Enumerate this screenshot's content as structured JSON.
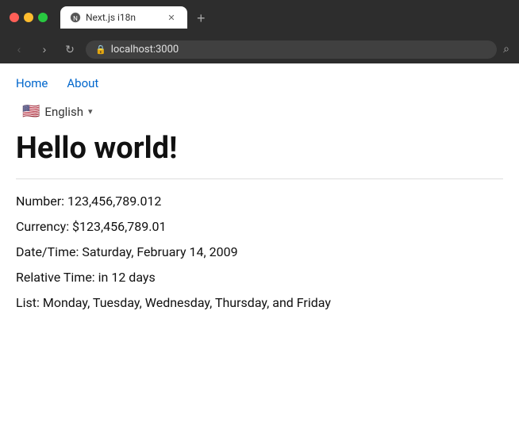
{
  "browser": {
    "tab_title": "Next.js i18n",
    "url": "localhost:3000",
    "new_tab_label": "+"
  },
  "nav": {
    "back_label": "←",
    "forward_label": "→",
    "refresh_label": "↻"
  },
  "page": {
    "nav_links": [
      {
        "label": "Home",
        "active": true
      },
      {
        "label": "About",
        "active": false
      }
    ],
    "language": {
      "flag": "🇺🇸",
      "label": "English"
    },
    "heading": "Hello world!",
    "items": [
      {
        "label": "Number:",
        "value": "123,456,789.012"
      },
      {
        "label": "Currency:",
        "value": "$123,456,789.01"
      },
      {
        "label": "Date/Time:",
        "value": "Saturday, February 14, 2009"
      },
      {
        "label": "Relative Time:",
        "value": "in 12 days"
      },
      {
        "label": "List:",
        "value": "Monday, Tuesday, Wednesday, Thursday, and Friday"
      }
    ]
  },
  "colors": {
    "link": "#0066cc",
    "text": "#111111",
    "muted": "#999999"
  }
}
